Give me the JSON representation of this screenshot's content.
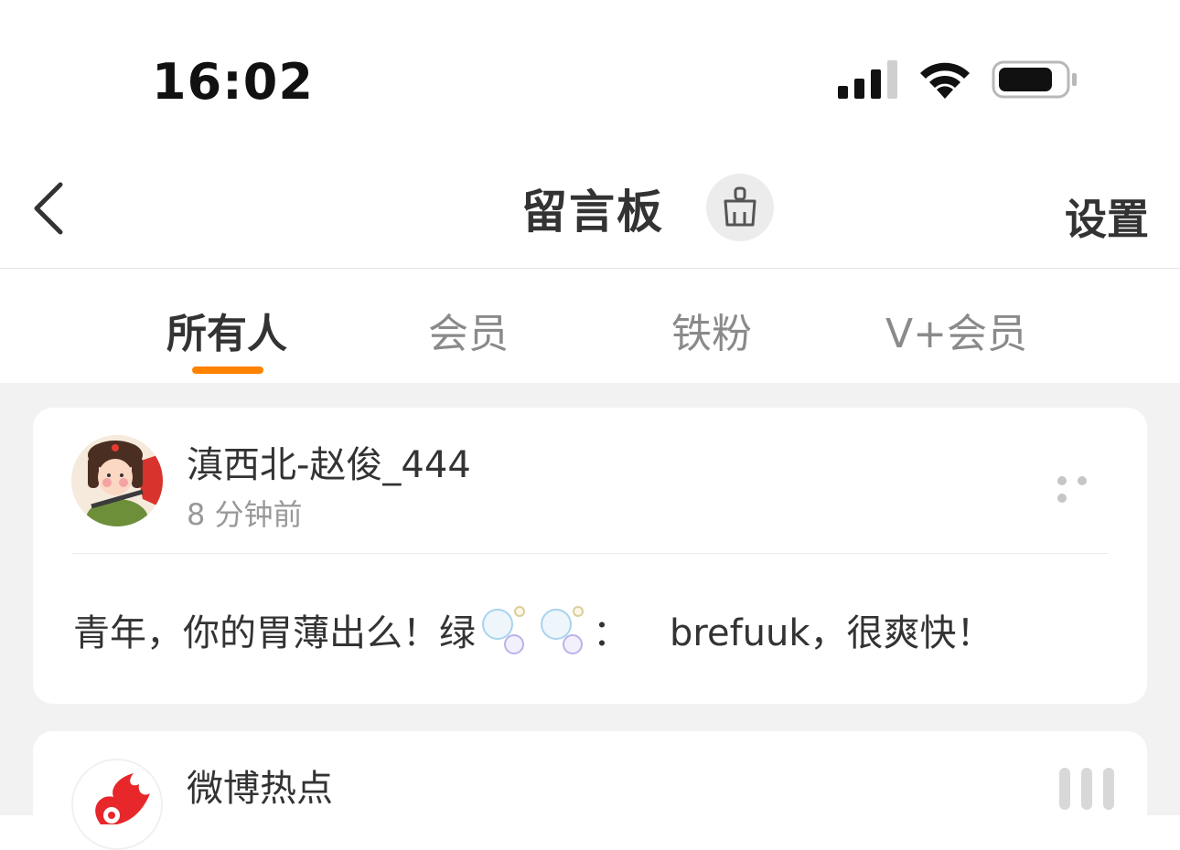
{
  "status_bar": {
    "time": "16:02"
  },
  "header": {
    "title": "留言板",
    "settings_label": "设置",
    "back_icon": "chevron-left-icon",
    "clean_icon": "broom-icon"
  },
  "tabs": [
    {
      "label": "所有人",
      "active": true
    },
    {
      "label": "会员",
      "active": false
    },
    {
      "label": "铁粉",
      "active": false
    },
    {
      "label": "V+会员",
      "active": false
    }
  ],
  "accent_color": "#ff8200",
  "posts": [
    {
      "username": "滇西北-赵俊_444",
      "time": "8 分钟前",
      "message_prefix": "青年，你的胃薄出么！绿",
      "message_sep": "：",
      "message_brand": "brefuuk，",
      "message_suffix": "很爽快！",
      "emoji_icon": "bubbles-icon"
    },
    {
      "username": "微博热点",
      "avatar_icon": "weibo-hot-flame-icon"
    }
  ]
}
